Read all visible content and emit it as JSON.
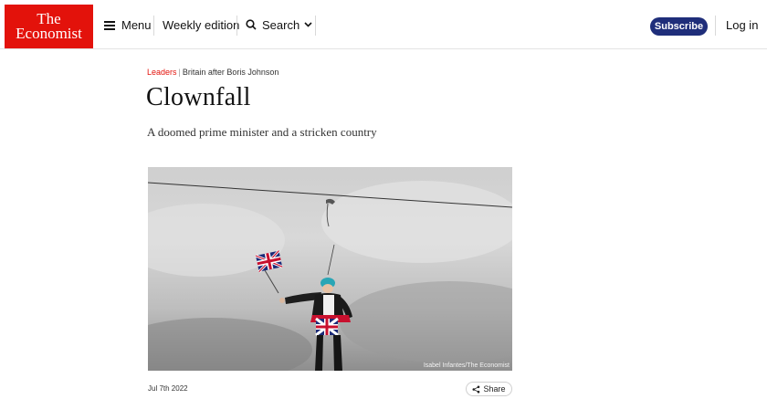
{
  "header": {
    "logo": {
      "line1": "The",
      "line2": "Economist"
    },
    "menu_label": "Menu",
    "weekly_label": "Weekly edition",
    "search_label": "Search",
    "subscribe_label": "Subscribe",
    "login_label": "Log in"
  },
  "article": {
    "section": "Leaders",
    "separator": "|",
    "topic": "Britain after Boris Johnson",
    "headline": "Clownfall",
    "standfirst": "A doomed prime minister and a stricken country",
    "image_credit": "Isabel Infantes/The Economist",
    "date": "Jul 7th 2022",
    "share_label": "Share"
  },
  "colors": {
    "brand_red": "#e3120b",
    "subscribe_bg": "#1f2e7a"
  }
}
